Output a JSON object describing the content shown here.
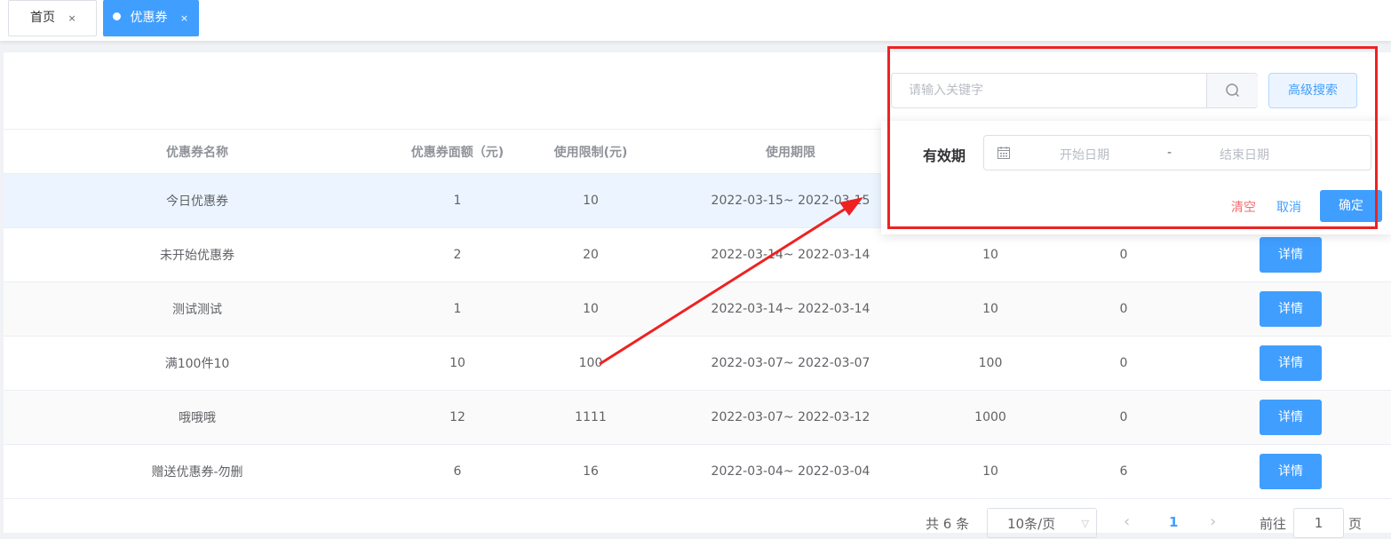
{
  "tabs": [
    {
      "label": "首页",
      "close": "×"
    },
    {
      "label": "优惠券",
      "close": "×"
    }
  ],
  "search": {
    "placeholder": "请输入关键字",
    "advanced_label": "高级搜索"
  },
  "table": {
    "headers": [
      "优惠券名称",
      "优惠券面额（元)",
      "使用限制(元)",
      "使用期限",
      "",
      "",
      ""
    ],
    "rows": [
      {
        "name": "今日优惠券",
        "amount": "1",
        "limit": "10",
        "period": "2022-03-15~ 2022-03-15",
        "col5": "",
        "col6": "",
        "action": ""
      },
      {
        "name": "未开始优惠券",
        "amount": "2",
        "limit": "20",
        "period": "2022-03-14~ 2022-03-14",
        "col5": "10",
        "col6": "0",
        "action": "详情"
      },
      {
        "name": "测试测试",
        "amount": "1",
        "limit": "10",
        "period": "2022-03-14~ 2022-03-14",
        "col5": "10",
        "col6": "0",
        "action": "详情"
      },
      {
        "name": "满100件10",
        "amount": "10",
        "limit": "100",
        "period": "2022-03-07~ 2022-03-07",
        "col5": "100",
        "col6": "0",
        "action": "详情"
      },
      {
        "name": "哦哦哦",
        "amount": "12",
        "limit": "1111",
        "period": "2022-03-07~ 2022-03-12",
        "col5": "1000",
        "col6": "0",
        "action": "详情"
      },
      {
        "name": "赠送优惠券-勿删",
        "amount": "6",
        "limit": "16",
        "period": "2022-03-04~ 2022-03-04",
        "col5": "10",
        "col6": "6",
        "action": "详情"
      }
    ]
  },
  "popover": {
    "label": "有效期",
    "start_placeholder": "开始日期",
    "separator": "-",
    "end_placeholder": "结束日期",
    "clear": "清空",
    "cancel": "取消",
    "confirm": "确定"
  },
  "pagination": {
    "total": "共 6 条",
    "page_size": "10条/页",
    "current": "1",
    "goto_prefix": "前往",
    "goto_value": "1",
    "goto_suffix": "页"
  },
  "colors": {
    "primary": "#409eff",
    "danger": "#f56c6c",
    "annotation": "#ee2222"
  }
}
